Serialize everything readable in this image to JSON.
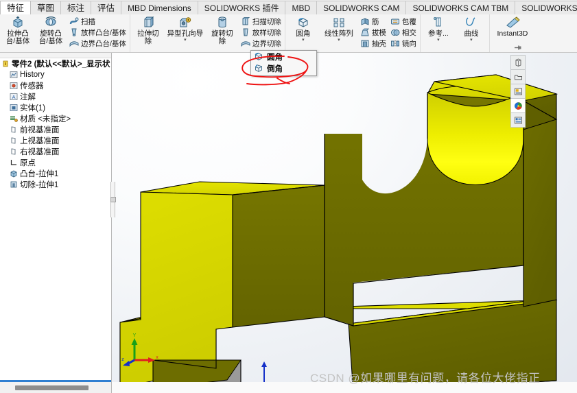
{
  "window": {
    "title": "SOLIDWORKS"
  },
  "tabs": [
    {
      "label": "特征",
      "active": true
    },
    {
      "label": "草图",
      "active": false
    },
    {
      "label": "标注",
      "active": false
    },
    {
      "label": "评估",
      "active": false
    },
    {
      "label": "MBD Dimensions",
      "active": false
    },
    {
      "label": "SOLIDWORKS 插件",
      "active": false
    },
    {
      "label": "MBD",
      "active": false
    },
    {
      "label": "SOLIDWORKS CAM",
      "active": false
    },
    {
      "label": "SOLIDWORKS CAM TBM",
      "active": false
    },
    {
      "label": "SOLIDWORKS Inspection",
      "active": false
    }
  ],
  "ribbon": {
    "groups": [
      {
        "name": "boss-group",
        "big": [
          {
            "icon": "extrude-boss-icon",
            "line1": "拉伸凸",
            "line2": "台/基体"
          },
          {
            "icon": "revolve-boss-icon",
            "line1": "旋转凸",
            "line2": "台/基体"
          }
        ],
        "small": [
          {
            "icon": "swept-boss-icon",
            "label": "扫描"
          },
          {
            "icon": "lofted-boss-icon",
            "label": "放样凸台/基体"
          },
          {
            "icon": "boundary-boss-icon",
            "label": "边界凸台/基体"
          }
        ]
      },
      {
        "name": "cut-group",
        "big": [
          {
            "icon": "extrude-cut-icon",
            "line1": "拉伸切",
            "line2": "除"
          },
          {
            "icon": "hole-wizard-icon",
            "line1": "异型孔向导",
            "line2": "",
            "caret": "▾"
          },
          {
            "icon": "revolve-cut-icon",
            "line1": "旋转切",
            "line2": "除"
          }
        ],
        "small": [
          {
            "icon": "swept-cut-icon",
            "label": "扫描切除"
          },
          {
            "icon": "lofted-cut-icon",
            "label": "放样切除"
          },
          {
            "icon": "boundary-cut-icon",
            "label": "边界切除"
          }
        ]
      },
      {
        "name": "feature-group",
        "big": [
          {
            "icon": "fillet-icon",
            "line1": "圆角",
            "line2": "",
            "caret": "▾",
            "active": true
          },
          {
            "icon": "linear-pattern-icon",
            "line1": "线性阵列",
            "line2": "",
            "caret": "▾"
          }
        ],
        "small": [
          {
            "icon": "rib-icon",
            "label": "筋"
          },
          {
            "icon": "draft-icon",
            "label": "拔模"
          },
          {
            "icon": "shell-icon",
            "label": "抽壳"
          }
        ],
        "small2": [
          {
            "icon": "wrap-icon",
            "label": "包覆"
          },
          {
            "icon": "intersect-icon",
            "label": "相交"
          },
          {
            "icon": "mirror-icon",
            "label": "镜向"
          }
        ]
      },
      {
        "name": "reference-group",
        "big": [
          {
            "icon": "reference-geometry-icon",
            "line1": "参考...",
            "line2": "",
            "caret": "▾"
          },
          {
            "icon": "curves-icon",
            "line1": "曲线",
            "line2": "",
            "caret": "▾"
          }
        ],
        "small": []
      },
      {
        "name": "instant3d-group",
        "big": [
          {
            "icon": "instant3d-icon",
            "line1": "Instant3D",
            "line2": "",
            "wide": true
          }
        ],
        "small": []
      }
    ]
  },
  "dropdown": {
    "name": "fillet-chamfer-menu",
    "items": [
      {
        "icon": "fillet-icon",
        "label": "圆角"
      },
      {
        "icon": "chamfer-icon",
        "label": "倒角",
        "annotated": true
      }
    ]
  },
  "annotation": {
    "color": "#ee1111",
    "target": "倒角"
  },
  "feature_tree": {
    "root": {
      "icon": "part-icon",
      "label": "零件2  (默认<<默认>_显示状"
    },
    "items": [
      {
        "icon": "history-icon",
        "label": "History"
      },
      {
        "icon": "sensors-icon",
        "label": "传感器"
      },
      {
        "icon": "annotations-icon",
        "label": "注解"
      },
      {
        "icon": "solid-bodies-icon",
        "label": "实体(1)"
      },
      {
        "icon": "material-icon",
        "label": "材质 <未指定>"
      },
      {
        "icon": "plane-icon",
        "label": "前视基准面"
      },
      {
        "icon": "plane-icon",
        "label": "上视基准面"
      },
      {
        "icon": "plane-icon",
        "label": "右视基准面"
      },
      {
        "icon": "origin-icon",
        "label": "原点"
      },
      {
        "icon": "boss-extrude-icon",
        "label": "凸台-拉伸1"
      },
      {
        "icon": "cut-extrude-icon",
        "label": "切除-拉伸1"
      }
    ]
  },
  "view_toolbar": {
    "pin": {
      "icon": "pin-icon"
    },
    "buttons": [
      {
        "icon": "display-style-icon",
        "name": "display-style-button"
      },
      {
        "icon": "hide-show-icon",
        "name": "hide-show-button"
      },
      {
        "icon": "scene-icon",
        "name": "scene-button"
      },
      {
        "icon": "appearance-icon",
        "name": "appearance-button",
        "selected": true
      },
      {
        "icon": "view-settings-icon",
        "name": "view-settings-button"
      }
    ]
  },
  "triad": {
    "x_label": "x",
    "y_label": "Y",
    "z_label": "z",
    "x_color": "#e02020",
    "y_color": "#18a018",
    "z_color": "#1430c8"
  },
  "model": {
    "name": "t-slot-bracket",
    "face_color_light": "#f5f500",
    "face_color_mid": "#d8d800",
    "face_color_dark": "#6b6b00",
    "edge_color": "#000000"
  },
  "watermark": {
    "text": "CSDN @如果哪里有问题，请各位大佬指正",
    "color": "#c3c3c3"
  },
  "scrollbar": {
    "name": "tree-horizontal-scrollbar"
  }
}
